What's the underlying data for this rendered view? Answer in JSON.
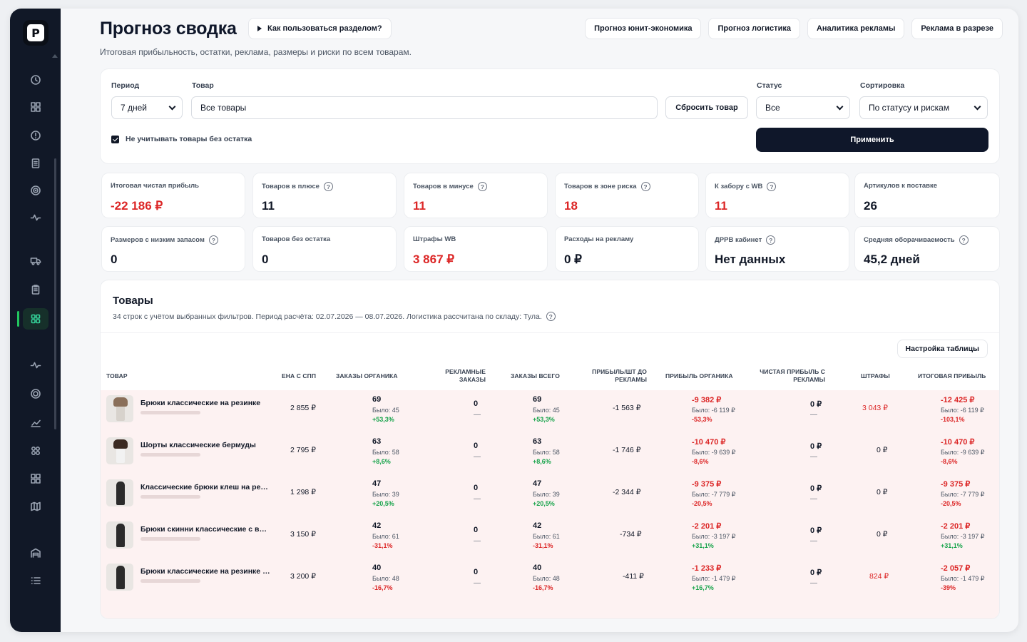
{
  "app": {
    "logo_letter": "P",
    "title": "Прогноз сводка",
    "help_button": "Как пользоваться разделом?",
    "subtitle": "Итоговая прибыльность, остатки, реклама, размеры и риски по всем товарам.",
    "top_tabs": [
      "Прогноз юнит-экономика",
      "Прогноз логистика",
      "Аналитика рекламы",
      "Реклама в разрезе"
    ]
  },
  "sidebar": {
    "icons": [
      "clock-icon",
      "grid-icon",
      "alert-circle-icon",
      "document-icon",
      "target-icon",
      "pulse-icon",
      "truck-icon",
      "clipboard-icon",
      "dashboard-icon",
      "activity-icon",
      "radar-icon",
      "trend-icon",
      "apps-icon",
      "layout-icon",
      "map-icon",
      "warehouse-icon",
      "list-icon"
    ],
    "active": "dashboard-icon"
  },
  "filters": {
    "period_label": "Период",
    "period_value": "7 дней",
    "product_label": "Товар",
    "product_value": "Все товары",
    "reset_button": "Сбросить товар",
    "status_label": "Статус",
    "status_value": "Все",
    "sort_label": "Сортировка",
    "sort_value": "По статусу и рискам",
    "exclude_checkbox": "Не учитывать товары без остатка",
    "apply_button": "Применить"
  },
  "kpis": [
    {
      "label": "Итоговая чистая прибыль",
      "value": "-22 186 ₽",
      "negative": true,
      "help": false
    },
    {
      "label": "Товаров в плюсе",
      "value": "11",
      "negative": false,
      "help": true
    },
    {
      "label": "Товаров в минусе",
      "value": "11",
      "negative": true,
      "help": true
    },
    {
      "label": "Товаров в зоне риска",
      "value": "18",
      "negative": true,
      "help": true
    },
    {
      "label": "К забору с WB",
      "value": "11",
      "negative": true,
      "help": true
    },
    {
      "label": "Артикулов к поставке",
      "value": "26",
      "negative": false,
      "help": false
    },
    {
      "label": "Размеров с низким запасом",
      "value": "0",
      "negative": false,
      "help": true
    },
    {
      "label": "Товаров без остатка",
      "value": "0",
      "negative": false,
      "help": false
    },
    {
      "label": "Штрафы WB",
      "value": "3 867 ₽",
      "negative": true,
      "help": false
    },
    {
      "label": "Расходы на рекламу",
      "value": "0 ₽",
      "negative": false,
      "help": false
    },
    {
      "label": "ДРРВ кабинет",
      "value": "Нет данных",
      "negative": false,
      "help": true
    },
    {
      "label": "Средняя оборачиваемость",
      "value": "45,2 дней",
      "negative": false,
      "help": true
    }
  ],
  "products": {
    "title": "Товары",
    "subtitle": "34 строк с учётом выбранных фильтров. Период расчёта: 02.07.2026 — 08.07.2026. Логистика рассчитана по складу: Тула.",
    "settings_button": "Настройка таблицы",
    "columns": [
      "Товар",
      "Ена с СПП",
      "Заказы органика",
      "Рекламные заказы",
      "Заказы всего",
      "Прибыль/шт до рекламы",
      "Прибыль органика",
      "Чистая прибыль с рекламы",
      "Штрафы",
      "Итоговая прибыль"
    ],
    "rows": [
      {
        "name": "Брюки классические на резинке",
        "price": "2 855 ₽",
        "org": "69",
        "org_was": "Было: 45",
        "org_delta": "+53,3%",
        "ads": "0",
        "ads_sub": "—",
        "total": "69",
        "total_was": "Было: 45",
        "total_delta": "+53,3%",
        "ppu": "-1 563 ₽",
        "porg": "-9 382 ₽",
        "porg_was": "Было: -6 119 ₽",
        "porg_delta": "-53,3%",
        "net_ads": "0 ₽",
        "net_ads_sub": "—",
        "fines": "3 043 ₽",
        "fines_red": true,
        "final": "-12 425 ₽",
        "final_was": "Было: -6 119 ₽",
        "final_delta": "-103,1%"
      },
      {
        "name": "Шорты классические бермуды",
        "price": "2 795 ₽",
        "org": "63",
        "org_was": "Было: 58",
        "org_delta": "+8,6%",
        "ads": "0",
        "ads_sub": "—",
        "total": "63",
        "total_was": "Было: 58",
        "total_delta": "+8,6%",
        "ppu": "-1 746 ₽",
        "porg": "-10 470 ₽",
        "porg_was": "Было: -9 639 ₽",
        "porg_delta": "-8,6%",
        "net_ads": "0 ₽",
        "net_ads_sub": "—",
        "fines": "0 ₽",
        "fines_red": false,
        "final": "-10 470 ₽",
        "final_was": "Было: -9 639 ₽",
        "final_delta": "-8,6%"
      },
      {
        "name": "Классические брюки клеш на ре…",
        "price": "1 298 ₽",
        "org": "47",
        "org_was": "Было: 39",
        "org_delta": "+20,5%",
        "ads": "0",
        "ads_sub": "—",
        "total": "47",
        "total_was": "Было: 39",
        "total_delta": "+20,5%",
        "ppu": "-2 344 ₽",
        "porg": "-9 375 ₽",
        "porg_was": "Было: -7 779 ₽",
        "porg_delta": "-20,5%",
        "net_ads": "0 ₽",
        "net_ads_sub": "—",
        "fines": "0 ₽",
        "fines_red": false,
        "final": "-9 375 ₽",
        "final_was": "Было: -7 779 ₽",
        "final_delta": "-20,5%"
      },
      {
        "name": "Брюки скинни классические с в…",
        "price": "3 150 ₽",
        "org": "42",
        "org_was": "Было: 61",
        "org_delta": "-31,1%",
        "ads": "0",
        "ads_sub": "—",
        "total": "42",
        "total_was": "Было: 61",
        "total_delta": "-31,1%",
        "ppu": "-734 ₽",
        "porg": "-2 201 ₽",
        "porg_was": "Было: -3 197 ₽",
        "porg_delta": "+31,1%",
        "net_ads": "0 ₽",
        "net_ads_sub": "—",
        "fines": "0 ₽",
        "fines_red": false,
        "final": "-2 201 ₽",
        "final_was": "Было: -3 197 ₽",
        "final_delta": "+31,1%"
      },
      {
        "name": "Брюки классические на резинке …",
        "price": "3 200 ₽",
        "org": "40",
        "org_was": "Было: 48",
        "org_delta": "-16,7%",
        "ads": "0",
        "ads_sub": "—",
        "total": "40",
        "total_was": "Было: 48",
        "total_delta": "-16,7%",
        "ppu": "-411 ₽",
        "porg": "-1 233 ₽",
        "porg_was": "Было: -1 479 ₽",
        "porg_delta": "+16,7%",
        "net_ads": "0 ₽",
        "net_ads_sub": "—",
        "fines": "824 ₽",
        "fines_red": true,
        "final": "-2 057 ₽",
        "final_was": "Было: -1 479 ₽",
        "final_delta": "-39%"
      }
    ]
  },
  "colors": {
    "accent": "#0f172a",
    "negative": "#dc2626",
    "positive": "#16a34a",
    "active_nav": "#34d399"
  }
}
